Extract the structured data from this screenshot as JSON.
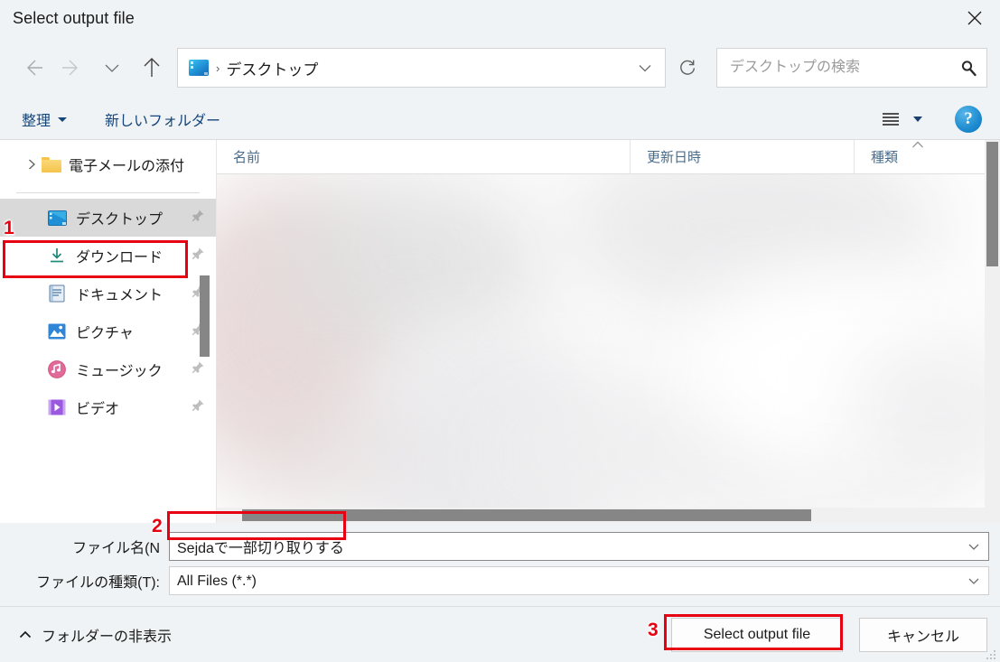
{
  "window": {
    "title": "Select output file",
    "close_icon": "close-icon"
  },
  "nav": {
    "back_icon": "arrow-left-icon",
    "forward_icon": "arrow-right-icon",
    "recent_icon": "chevron-down-icon",
    "up_icon": "arrow-up-icon",
    "refresh_icon": "refresh-icon",
    "address": {
      "folder_icon": "desktop-icon",
      "separator": "›",
      "crumb": "デスクトップ",
      "dropdown_icon": "chevron-down-icon"
    },
    "search": {
      "placeholder": "デスクトップの検索",
      "value": "",
      "icon": "search-icon"
    }
  },
  "command_bar": {
    "organize_label": "整理",
    "new_folder_label": "新しいフォルダー",
    "view_icon": "list-view-icon",
    "help_label": "?"
  },
  "sidebar": {
    "tree": [
      {
        "label": "電子メールの添付",
        "chevron_icon": "chevron-right-icon",
        "icon": "folder-icon"
      }
    ],
    "quick_access": [
      {
        "label": "デスクトップ",
        "icon": "desktop-icon",
        "pin_icon": "pin-icon",
        "selected": true
      },
      {
        "label": "ダウンロード",
        "icon": "download-icon",
        "pin_icon": "pin-icon",
        "selected": false
      },
      {
        "label": "ドキュメント",
        "icon": "document-icon",
        "pin_icon": "pin-icon",
        "selected": false
      },
      {
        "label": "ピクチャ",
        "icon": "picture-icon",
        "pin_icon": "pin-icon",
        "selected": false
      },
      {
        "label": "ミュージック",
        "icon": "music-icon",
        "pin_icon": "pin-icon",
        "selected": false
      },
      {
        "label": "ビデオ",
        "icon": "video-icon",
        "pin_icon": "pin-icon",
        "selected": false
      }
    ]
  },
  "file_list": {
    "columns": [
      {
        "label": "名前",
        "sorted": false
      },
      {
        "label": "更新日時",
        "sorted": false
      },
      {
        "label": "種類",
        "sorted": true,
        "sort_icon": "chevron-up-icon"
      }
    ],
    "rows": []
  },
  "form": {
    "filename_label": "ファイル名(N",
    "filename_value": "Sejdaで一部切り取りする",
    "filetype_label": "ファイルの種類(T):",
    "filetype_value": "All Files (*.*)",
    "dropdown_icon": "chevron-down-icon"
  },
  "footer": {
    "hide_folders_label": "フォルダーの非表示",
    "hide_folders_icon": "chevron-up-icon",
    "submit_label": "Select output file",
    "cancel_label": "キャンセル"
  },
  "annotations": {
    "color": "#e60012",
    "markers": [
      {
        "number": "1",
        "target": "sidebar-item-desktop"
      },
      {
        "number": "2",
        "target": "filename-input"
      },
      {
        "number": "3",
        "target": "select-output-file-button"
      }
    ]
  }
}
